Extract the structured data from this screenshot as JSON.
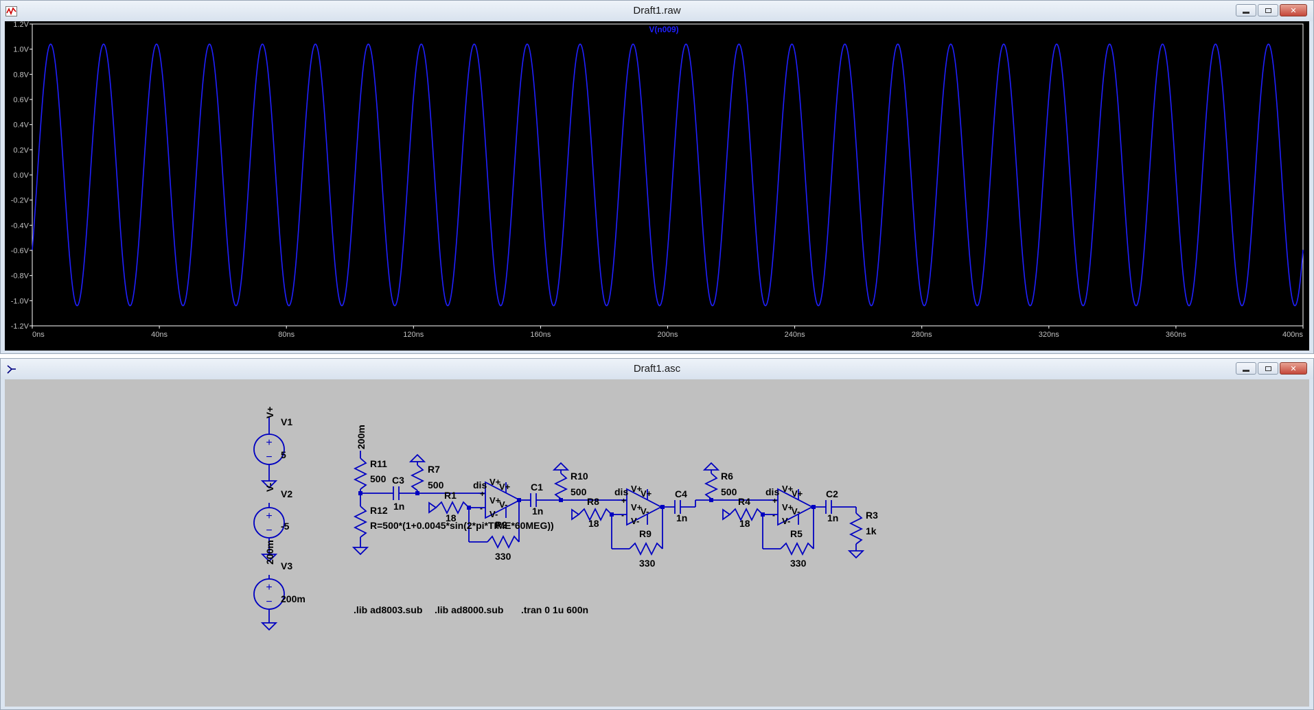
{
  "plot_window": {
    "title": "Draft1.raw",
    "icon": "waveform-icon",
    "trace_label": "V(n009)",
    "trace_color": "#2020ff",
    "background": "#000000",
    "axis_label_color": "#c0c0c0"
  },
  "schematic_window": {
    "title": "Draft1.asc",
    "icon": "schematic-icon",
    "background": "#c0c0c0",
    "wire_color": "#0000c0",
    "text_color": "#000000"
  },
  "chart_data": {
    "type": "line",
    "title": "",
    "xlabel": "",
    "ylabel": "",
    "series": [
      {
        "name": "V(n009)",
        "amplitude": 1.04,
        "frequency_hz": 60000000,
        "offset": 0,
        "phase_deg": -35
      }
    ],
    "xlim": [
      0,
      400
    ],
    "ylim": [
      -1.2,
      1.2
    ],
    "x_ticks": [
      "0ns",
      "40ns",
      "80ns",
      "120ns",
      "160ns",
      "200ns",
      "240ns",
      "280ns",
      "320ns",
      "360ns",
      "400ns"
    ],
    "y_ticks": [
      "1.2V",
      "1.0V",
      "0.8V",
      "0.6V",
      "0.4V",
      "0.2V",
      "0.0V",
      "-0.2V",
      "-0.4V",
      "-0.6V",
      "-0.8V",
      "-1.0V",
      "-1.2V"
    ],
    "grid": false,
    "legend": "top-center"
  },
  "schematic": {
    "sources": {
      "v1": {
        "name": "V1",
        "net": "V+",
        "value": "5"
      },
      "v2": {
        "name": "V2",
        "net": "V-",
        "value": "-5"
      },
      "v3": {
        "name": "V3",
        "net": "200m",
        "value": "200m"
      }
    },
    "bias_label": "200m",
    "resistors": {
      "r11": {
        "name": "R11",
        "value": "500"
      },
      "r12": {
        "name": "R12",
        "value": "R=500*(1+0.0045*sin(2*pi*TIME*60MEG))"
      },
      "r7": {
        "name": "R7",
        "value": "500"
      },
      "r1": {
        "name": "R1",
        "value": "18"
      },
      "r2": {
        "name": "R2",
        "value": "330"
      },
      "r10": {
        "name": "R10",
        "value": "500"
      },
      "r8": {
        "name": "R8",
        "value": "18"
      },
      "r9": {
        "name": "R9",
        "value": "330"
      },
      "r6": {
        "name": "R6",
        "value": "500"
      },
      "r4": {
        "name": "R4",
        "value": "18"
      },
      "r5": {
        "name": "R5",
        "value": "330"
      },
      "r3": {
        "name": "R3",
        "value": "1k"
      }
    },
    "capacitors": {
      "c3": {
        "name": "C3",
        "value": "1n"
      },
      "c1": {
        "name": "C1",
        "value": "1n"
      },
      "c4": {
        "name": "C4",
        "value": "1n"
      },
      "c2": {
        "name": "C2",
        "value": "1n"
      }
    },
    "opamp_pins": {
      "dis": "dis",
      "vplus": "V+",
      "vminus": "V-",
      "plus": "+",
      "minus": "-"
    },
    "directives": [
      ".lib ad8003.sub",
      ".lib ad8000.sub",
      ".tran 0 1u 600n"
    ]
  }
}
